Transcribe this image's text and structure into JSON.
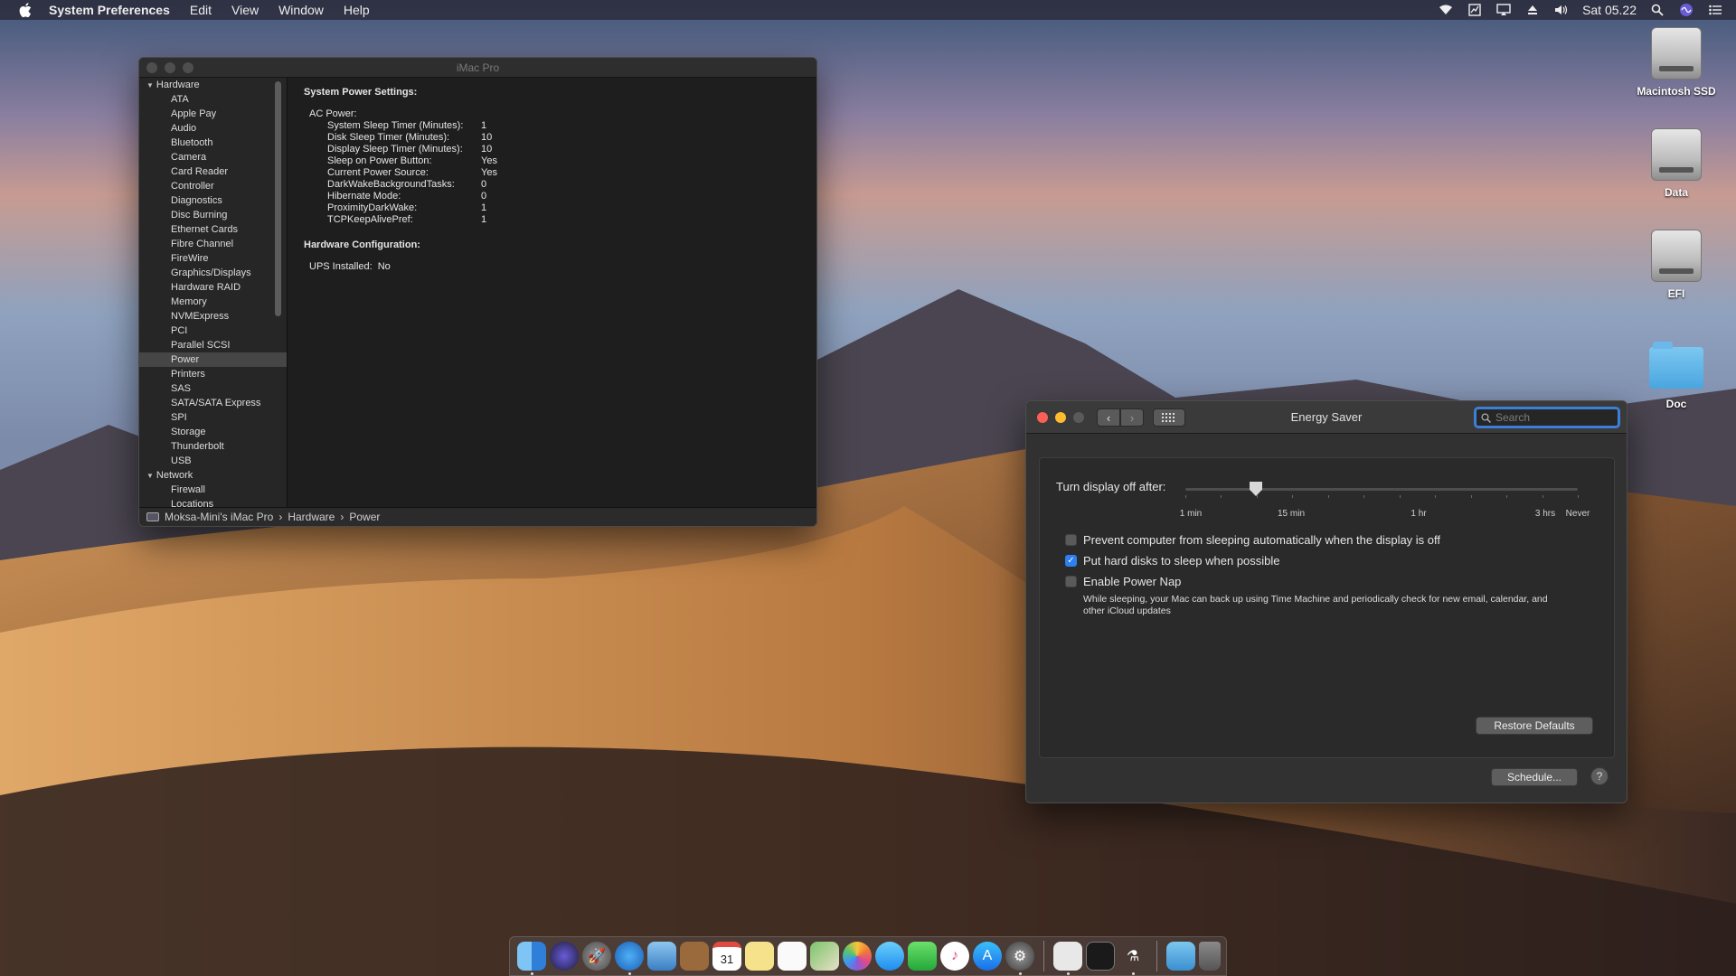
{
  "menubar": {
    "app_name": "System Preferences",
    "menus": [
      "Edit",
      "View",
      "Window",
      "Help"
    ],
    "clock": "Sat 05.22"
  },
  "desktop_icons": [
    {
      "label": "Macintosh SSD",
      "icon": "hard-drive-icon"
    },
    {
      "label": "Data",
      "icon": "hard-drive-icon"
    },
    {
      "label": "EFI",
      "icon": "hard-drive-icon"
    },
    {
      "label": "Doc",
      "icon": "folder-icon"
    }
  ],
  "sysinfo": {
    "title": "iMac Pro",
    "sidebar_hardware_label": "Hardware",
    "sidebar_hardware_items": [
      "ATA",
      "Apple Pay",
      "Audio",
      "Bluetooth",
      "Camera",
      "Card Reader",
      "Controller",
      "Diagnostics",
      "Disc Burning",
      "Ethernet Cards",
      "Fibre Channel",
      "FireWire",
      "Graphics/Displays",
      "Hardware RAID",
      "Memory",
      "NVMExpress",
      "PCI",
      "Parallel SCSI",
      "Power",
      "Printers",
      "SAS",
      "SATA/SATA Express",
      "SPI",
      "Storage",
      "Thunderbolt",
      "USB"
    ],
    "sidebar_selected": "Power",
    "sidebar_network_label": "Network",
    "sidebar_network_items": [
      "Firewall",
      "Locations"
    ],
    "section1_title": "System Power Settings:",
    "ac_power_label": "AC Power:",
    "ac_power": [
      {
        "k": "System Sleep Timer (Minutes):",
        "v": "1"
      },
      {
        "k": "Disk Sleep Timer (Minutes):",
        "v": "10"
      },
      {
        "k": "Display Sleep Timer (Minutes):",
        "v": "10"
      },
      {
        "k": "Sleep on Power Button:",
        "v": "Yes"
      },
      {
        "k": "Current Power Source:",
        "v": "Yes"
      },
      {
        "k": "DarkWakeBackgroundTasks:",
        "v": "0"
      },
      {
        "k": "Hibernate Mode:",
        "v": "0"
      },
      {
        "k": "ProximityDarkWake:",
        "v": "1"
      },
      {
        "k": "TCPKeepAlivePref:",
        "v": "1"
      }
    ],
    "section2_title": "Hardware Configuration:",
    "ups_label": "UPS Installed:",
    "ups_value": "No",
    "path": [
      "Moksa-Mini's iMac Pro",
      "Hardware",
      "Power"
    ]
  },
  "energy": {
    "title": "Energy Saver",
    "search_placeholder": "Search",
    "slider_label": "Turn display off after:",
    "slider_value_fraction": 0.18,
    "tick_labels": [
      "1 min",
      "15 min",
      "1 hr",
      "3 hrs",
      "Never"
    ],
    "checkboxes": [
      {
        "label": "Prevent computer from sleeping automatically when the display is off",
        "checked": false
      },
      {
        "label": "Put hard disks to sleep when possible",
        "checked": true
      },
      {
        "label": "Enable Power Nap",
        "checked": false
      }
    ],
    "power_nap_desc": "While sleeping, your Mac can back up using Time Machine and periodically check for new email, calendar, and other iCloud updates",
    "restore_defaults": "Restore Defaults",
    "schedule": "Schedule...",
    "help": "?",
    "accent": "#2e7ff0"
  },
  "dock": {
    "items": [
      "finder-icon",
      "siri-icon",
      "launchpad-icon",
      "safari-icon",
      "mail-icon",
      "notes-brown-icon",
      "calendar-icon",
      "stickies-icon",
      "reminders-icon",
      "maps-icon",
      "photos-icon",
      "messages-icon",
      "facetime-icon",
      "itunes-icon",
      "app-store-icon",
      "system-preferences-icon",
      "textedit-icon",
      "activity-monitor-icon",
      "script-editor-icon",
      "downloads-folder-icon",
      "trash-icon"
    ],
    "calendar_day": "31"
  }
}
